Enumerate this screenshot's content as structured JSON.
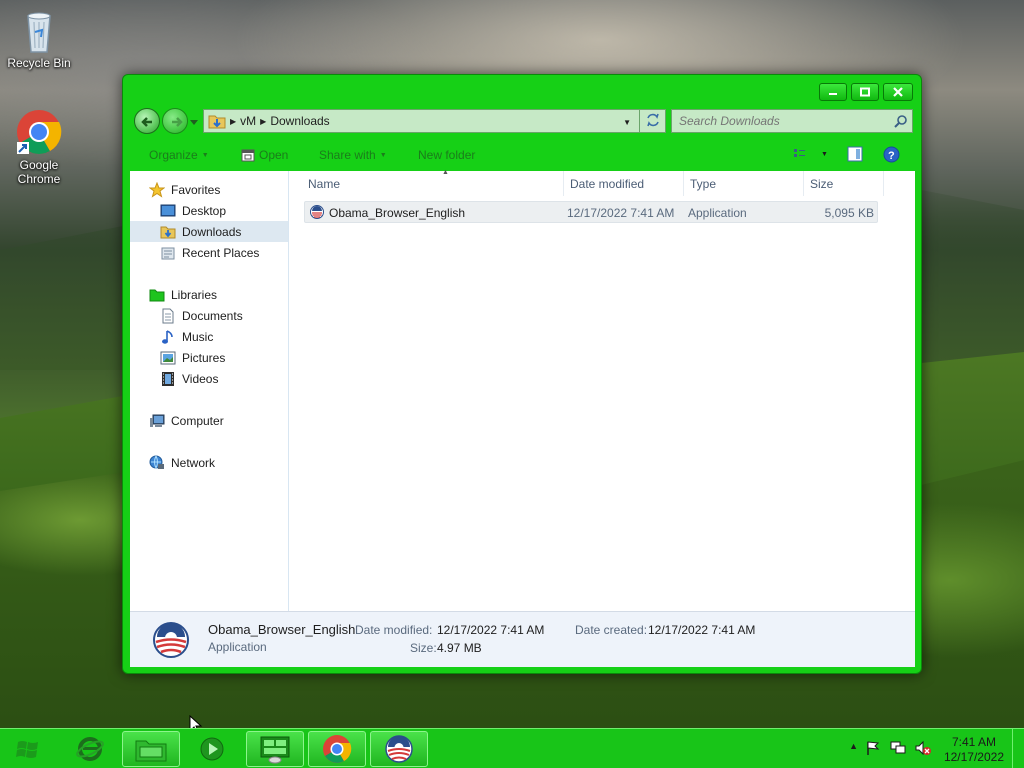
{
  "desktop": {
    "icons": [
      {
        "label": "Recycle Bin",
        "icon": "recycle-bin-icon"
      },
      {
        "label": "Google\nChrome",
        "icon": "chrome-icon"
      }
    ]
  },
  "window": {
    "address": {
      "crumbs": [
        "vM",
        "Downloads"
      ]
    },
    "search": {
      "placeholder": "Search Downloads"
    },
    "toolbar": {
      "organize": "Organize",
      "open": "Open",
      "share_with": "Share with",
      "new_folder": "New folder"
    },
    "sidebar": {
      "favorites": "Favorites",
      "desktop": "Desktop",
      "downloads": "Downloads",
      "recent_places": "Recent Places",
      "libraries": "Libraries",
      "documents": "Documents",
      "music": "Music",
      "pictures": "Pictures",
      "videos": "Videos",
      "computer": "Computer",
      "network": "Network"
    },
    "columns": {
      "name": "Name",
      "date_modified": "Date modified",
      "type": "Type",
      "size": "Size"
    },
    "files": [
      {
        "name": "Obama_Browser_English",
        "date": "12/17/2022 7:41 AM",
        "type": "Application",
        "size": "5,095 KB"
      }
    ],
    "details": {
      "name": "Obama_Browser_English",
      "type": "Application",
      "date_modified_label": "Date modified:",
      "date_modified": "12/17/2022 7:41 AM",
      "date_created_label": "Date created:",
      "date_created": "12/17/2022 7:41 AM",
      "size_label": "Size:",
      "size": "4.97 MB"
    }
  },
  "taskbar": {
    "clock_time": "7:41 AM",
    "clock_date": "12/17/2022"
  },
  "colors": {
    "window_frame": "#16d016",
    "taskbar": "#18c518"
  }
}
